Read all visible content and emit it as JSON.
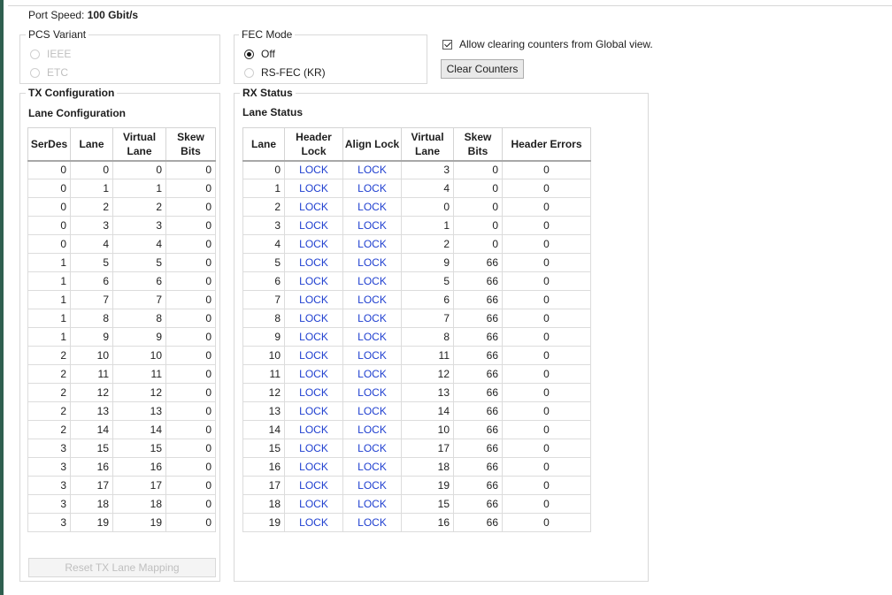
{
  "port_speed": {
    "label": "Port Speed:",
    "value": "100 Gbit/s"
  },
  "pcs_variant": {
    "legend": "PCS Variant",
    "options": [
      {
        "label": "IEEE",
        "selected": false,
        "enabled": false
      },
      {
        "label": "ETC",
        "selected": false,
        "enabled": false
      }
    ]
  },
  "fec_mode": {
    "legend": "FEC Mode",
    "options": [
      {
        "label": "Off",
        "selected": true,
        "enabled": true
      },
      {
        "label": "RS-FEC (KR)",
        "selected": false,
        "enabled": true
      }
    ]
  },
  "global_clear": {
    "checkbox_label": "Allow clearing counters from Global view.",
    "checked": true,
    "clear_button": "Clear Counters"
  },
  "tx": {
    "legend": "TX Configuration",
    "subtitle": "Lane Configuration",
    "columns": [
      "SerDes",
      "Lane",
      "Virtual Lane",
      "Skew Bits"
    ],
    "rows": [
      [
        "0",
        "0",
        "0",
        "0"
      ],
      [
        "0",
        "1",
        "1",
        "0"
      ],
      [
        "0",
        "2",
        "2",
        "0"
      ],
      [
        "0",
        "3",
        "3",
        "0"
      ],
      [
        "0",
        "4",
        "4",
        "0"
      ],
      [
        "1",
        "5",
        "5",
        "0"
      ],
      [
        "1",
        "6",
        "6",
        "0"
      ],
      [
        "1",
        "7",
        "7",
        "0"
      ],
      [
        "1",
        "8",
        "8",
        "0"
      ],
      [
        "1",
        "9",
        "9",
        "0"
      ],
      [
        "2",
        "10",
        "10",
        "0"
      ],
      [
        "2",
        "11",
        "11",
        "0"
      ],
      [
        "2",
        "12",
        "12",
        "0"
      ],
      [
        "2",
        "13",
        "13",
        "0"
      ],
      [
        "2",
        "14",
        "14",
        "0"
      ],
      [
        "3",
        "15",
        "15",
        "0"
      ],
      [
        "3",
        "16",
        "16",
        "0"
      ],
      [
        "3",
        "17",
        "17",
        "0"
      ],
      [
        "3",
        "18",
        "18",
        "0"
      ],
      [
        "3",
        "19",
        "19",
        "0"
      ]
    ],
    "reset_button": "Reset TX Lane Mapping"
  },
  "rx": {
    "legend": "RX Status",
    "subtitle": "Lane Status",
    "columns": [
      "Lane",
      "Header Lock",
      "Align Lock",
      "Virtual Lane",
      "Skew Bits",
      "Header Errors"
    ],
    "rows": [
      [
        "0",
        "LOCK",
        "LOCK",
        "3",
        "0",
        "0"
      ],
      [
        "1",
        "LOCK",
        "LOCK",
        "4",
        "0",
        "0"
      ],
      [
        "2",
        "LOCK",
        "LOCK",
        "0",
        "0",
        "0"
      ],
      [
        "3",
        "LOCK",
        "LOCK",
        "1",
        "0",
        "0"
      ],
      [
        "4",
        "LOCK",
        "LOCK",
        "2",
        "0",
        "0"
      ],
      [
        "5",
        "LOCK",
        "LOCK",
        "9",
        "66",
        "0"
      ],
      [
        "6",
        "LOCK",
        "LOCK",
        "5",
        "66",
        "0"
      ],
      [
        "7",
        "LOCK",
        "LOCK",
        "6",
        "66",
        "0"
      ],
      [
        "8",
        "LOCK",
        "LOCK",
        "7",
        "66",
        "0"
      ],
      [
        "9",
        "LOCK",
        "LOCK",
        "8",
        "66",
        "0"
      ],
      [
        "10",
        "LOCK",
        "LOCK",
        "11",
        "66",
        "0"
      ],
      [
        "11",
        "LOCK",
        "LOCK",
        "12",
        "66",
        "0"
      ],
      [
        "12",
        "LOCK",
        "LOCK",
        "13",
        "66",
        "0"
      ],
      [
        "13",
        "LOCK",
        "LOCK",
        "14",
        "66",
        "0"
      ],
      [
        "14",
        "LOCK",
        "LOCK",
        "10",
        "66",
        "0"
      ],
      [
        "15",
        "LOCK",
        "LOCK",
        "17",
        "66",
        "0"
      ],
      [
        "16",
        "LOCK",
        "LOCK",
        "18",
        "66",
        "0"
      ],
      [
        "17",
        "LOCK",
        "LOCK",
        "19",
        "66",
        "0"
      ],
      [
        "18",
        "LOCK",
        "LOCK",
        "15",
        "66",
        "0"
      ],
      [
        "19",
        "LOCK",
        "LOCK",
        "16",
        "66",
        "0"
      ]
    ]
  }
}
